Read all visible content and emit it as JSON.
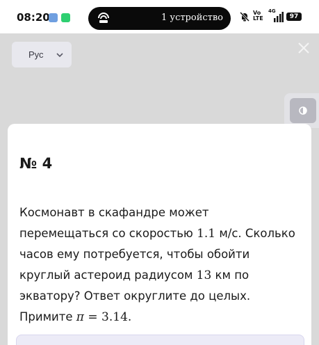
{
  "status_bar": {
    "time": "08:20",
    "island_text": "1 устройство",
    "volte_top": "Vo",
    "volte_bottom": "LTE",
    "signal_label": "4G",
    "battery": "97"
  },
  "page": {
    "language": "Рус",
    "task": {
      "number": "№ 4",
      "text_parts": {
        "p1": "Космонавт в скафандре может перемещаться со скоростью ",
        "speed": "1.1",
        "p2": " м/с. Сколько часов ему потребуется, чтобы обойти круглый астероид радиусом ",
        "radius": "13",
        "p3": " км по экватору? Ответ округлите до целых. Примите ",
        "pi": "π",
        "eq": " = ",
        "pi_value": "3.14",
        "p4": "."
      }
    }
  },
  "colors": {
    "overlay": "#d9d9d9",
    "card": "#ffffff",
    "text": "#1a1a1a",
    "answer_field": "#ecebf7"
  },
  "icons": [
    "app-icon-blue",
    "app-icon-green",
    "island-link-icon",
    "bell-off-icon",
    "signal-icon",
    "chevron-down-icon",
    "close-icon",
    "contrast-icon"
  ]
}
